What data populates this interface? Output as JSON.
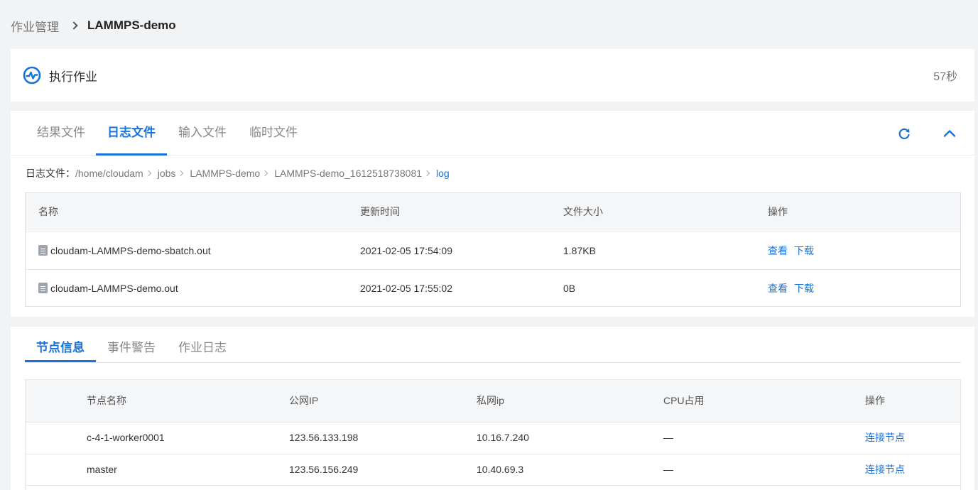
{
  "breadcrumb": {
    "parent": "作业管理",
    "current": "LAMMPS-demo"
  },
  "status": {
    "icon": "activity-pulse-icon",
    "title": "执行作业",
    "duration": "57秒"
  },
  "file_tabs": {
    "result": "结果文件",
    "log": "日志文件",
    "input": "输入文件",
    "temp": "临时文件",
    "active": "日志文件"
  },
  "path": {
    "label": "日志文件：",
    "segments": [
      "/home/cloudam",
      "jobs",
      "LAMMPS-demo",
      "LAMMPS-demo_1612518738081",
      "log"
    ]
  },
  "file_table": {
    "headers": {
      "name": "名称",
      "time": "更新时间",
      "size": "文件大小",
      "op": "操作"
    },
    "rows": [
      {
        "name": "cloudam-LAMMPS-demo-sbatch.out",
        "time": "2021-02-05 17:54:09",
        "size": "1.87KB",
        "view": "查看",
        "download": "下载"
      },
      {
        "name": "cloudam-LAMMPS-demo.out",
        "time": "2021-02-05 17:55:02",
        "size": "0B",
        "view": "查看",
        "download": "下载"
      }
    ]
  },
  "node_tabs": {
    "node": "节点信息",
    "event": "事件警告",
    "joblog": "作业日志",
    "active": "节点信息"
  },
  "node_table": {
    "headers": {
      "name": "节点名称",
      "public_ip": "公网IP",
      "private_ip": "私网ip",
      "cpu": "CPU占用",
      "op": "操作"
    },
    "rows": [
      {
        "name": "c-4-1-worker0001",
        "public_ip": "123.56.133.198",
        "private_ip": "10.16.7.240",
        "cpu": "—",
        "op": "连接节点"
      },
      {
        "name": "master",
        "public_ip": "123.56.156.249",
        "private_ip": "10.40.69.3",
        "cpu": "—",
        "op": "连接节点"
      }
    ]
  },
  "colors": {
    "accent": "#1a73d9",
    "background": "#f2f3f5"
  }
}
